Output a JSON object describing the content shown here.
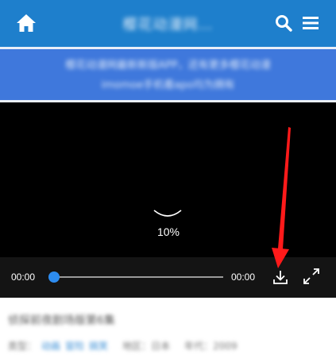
{
  "header": {
    "title": "樱花动漫网…",
    "home_icon": "home-icon",
    "search_icon": "search-icon",
    "menu_icon": "menu-icon",
    "background": "#1e7fcc"
  },
  "notice": {
    "line1": "樱花动漫网最新新版APP，还有更多樱花动漫",
    "line2": "imomoe手机看apo均为拥有",
    "background": "#3f78dc"
  },
  "player": {
    "loading_percent": "10%",
    "current_time": "00:00",
    "duration": "00:00",
    "progress": 0,
    "download_icon": "download-icon",
    "fullscreen_icon": "fullscreen-icon",
    "accent": "#2d8cf0",
    "annotation_color": "#ff1a1a"
  },
  "video_info": {
    "title": "侦探前夜剧场版第6集",
    "type_label": "类型：",
    "tags": [
      "动画",
      "冒险",
      "搞笑"
    ],
    "region": "地区：日本",
    "year": "年代：2009"
  }
}
